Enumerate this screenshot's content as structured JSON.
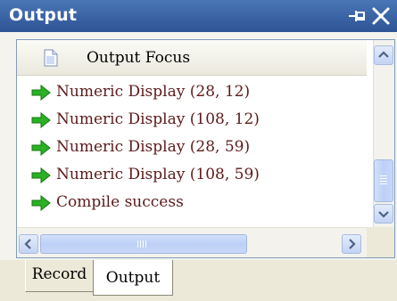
{
  "panel": {
    "title": "Output"
  },
  "list": {
    "header_label": "Output Focus",
    "items": [
      {
        "text": "Numeric Display (28, 12)"
      },
      {
        "text": "Numeric Display (108, 12)"
      },
      {
        "text": "Numeric Display (28, 59)"
      },
      {
        "text": "Numeric Display (108, 59)"
      },
      {
        "text": "Compile success"
      }
    ]
  },
  "tabs": [
    {
      "label": "Record",
      "active": false
    },
    {
      "label": "Output",
      "active": true
    }
  ],
  "icons": {
    "title_pin": "pin-icon",
    "title_close": "close-icon",
    "header": "document-icon",
    "row": "green-arrow-icon",
    "scroll_up": "chevron-up-icon",
    "scroll_down": "chevron-down-icon",
    "scroll_left": "chevron-left-icon",
    "scroll_right": "chevron-right-icon"
  },
  "colors": {
    "titlebar": "#3a63a4",
    "item_text": "#5c1a1a",
    "arrow": "#2bb026",
    "scroll_accent": "#bcd0f6"
  }
}
